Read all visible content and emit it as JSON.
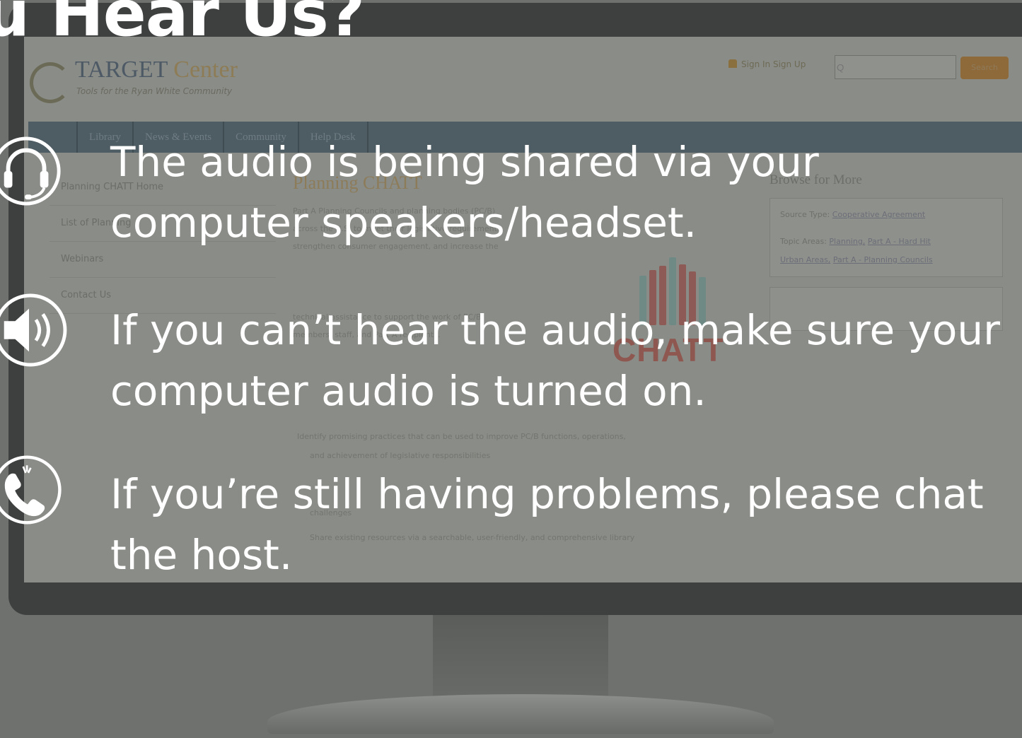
{
  "overlay": {
    "headline": "u Hear Us?",
    "items": [
      {
        "icon": "headset-icon",
        "line1": "The audio is being shared via your",
        "line2": "computer speakers/headset."
      },
      {
        "icon": "speaker-icon",
        "line1": "If you can’t hear the audio, make sure your",
        "line2": "computer audio is turned on."
      },
      {
        "icon": "phone-icon",
        "line1": "If you’re still having problems, please chat",
        "line2": "the host."
      }
    ]
  },
  "site": {
    "logo_name": "TARGET",
    "logo_center": "Center",
    "logo_tagline": "Tools for the Ryan White Community",
    "header_links": "Sign In  Sign Up",
    "search_placeholder": "Q",
    "search_button": "Search",
    "nav": [
      "Library",
      "News & Events",
      "Community",
      "Help Desk"
    ],
    "sidebar": [
      "Planning CHATT Home",
      "List of Planning",
      "Webinars",
      "Contact Us"
    ],
    "page_title": "Planning CHATT",
    "body_lines": [
      "Part A Planning Councils and planning bodies (PC/B)",
      "across the U.S. to meet their legislative requirements,",
      "strengthen consumer engagement, and increase the",
      "technical assistance to support the work of PC/B",
      "members, staff, and Part A recipients."
    ],
    "bullets": [
      "Identify promising practices that can be used to improve PC/B functions, operations,",
      "and achievement of legislative responsibilities",
      "challenges",
      "Share existing resources via a searchable, user-friendly, and comprehensive library"
    ],
    "chatt_word": "CHATT",
    "browse_title": "Browse for More",
    "source_type_label": "Source Type:",
    "source_type_value": "Cooperative Agreement",
    "topic_label": "Topic Areas:",
    "topic_value_1": "Planning,",
    "topic_value_2": "Part A - Hard Hit",
    "topic_value_3": "Urban Areas,",
    "topic_value_4": "Part A - Planning Councils"
  },
  "colors": {
    "overlay_text": "#ffffff",
    "page_bg": "#6f716f",
    "monitor_frame": "#3e403f",
    "nav_bar": "#4e5c63",
    "chatt_red": "#8e5750"
  }
}
